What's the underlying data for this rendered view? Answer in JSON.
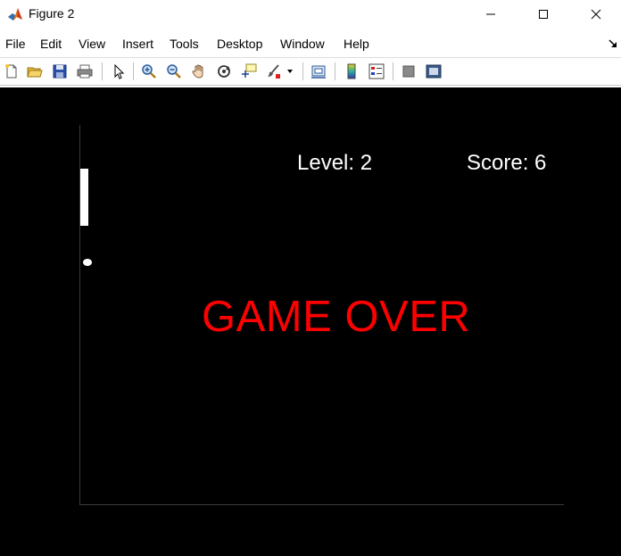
{
  "window": {
    "title": "Figure 2",
    "icon": "matlab-icon"
  },
  "menu": {
    "items": [
      "File",
      "Edit",
      "View",
      "Insert",
      "Tools",
      "Desktop",
      "Window",
      "Help"
    ]
  },
  "toolbar": {
    "buttons": [
      "new-figure-icon",
      "open-file-icon",
      "save-icon",
      "print-icon",
      "edit-plot-arrow-icon",
      "zoom-in-icon",
      "zoom-out-icon",
      "pan-hand-icon",
      "rotate-3d-icon",
      "data-cursor-icon",
      "brush-icon",
      "link-plot-icon",
      "insert-colorbar-icon",
      "insert-legend-icon",
      "hide-plot-tools-icon",
      "show-plot-tools-icon"
    ]
  },
  "game": {
    "level_label": "Level: 2",
    "score_label": "Score: 6",
    "status": "GAME OVER",
    "level": 2,
    "score": 6,
    "colors": {
      "background": "#000000",
      "hud_text": "#ffffff",
      "game_over": "#ff0000",
      "paddle": "#ffffff",
      "ball": "#ffffff"
    }
  }
}
